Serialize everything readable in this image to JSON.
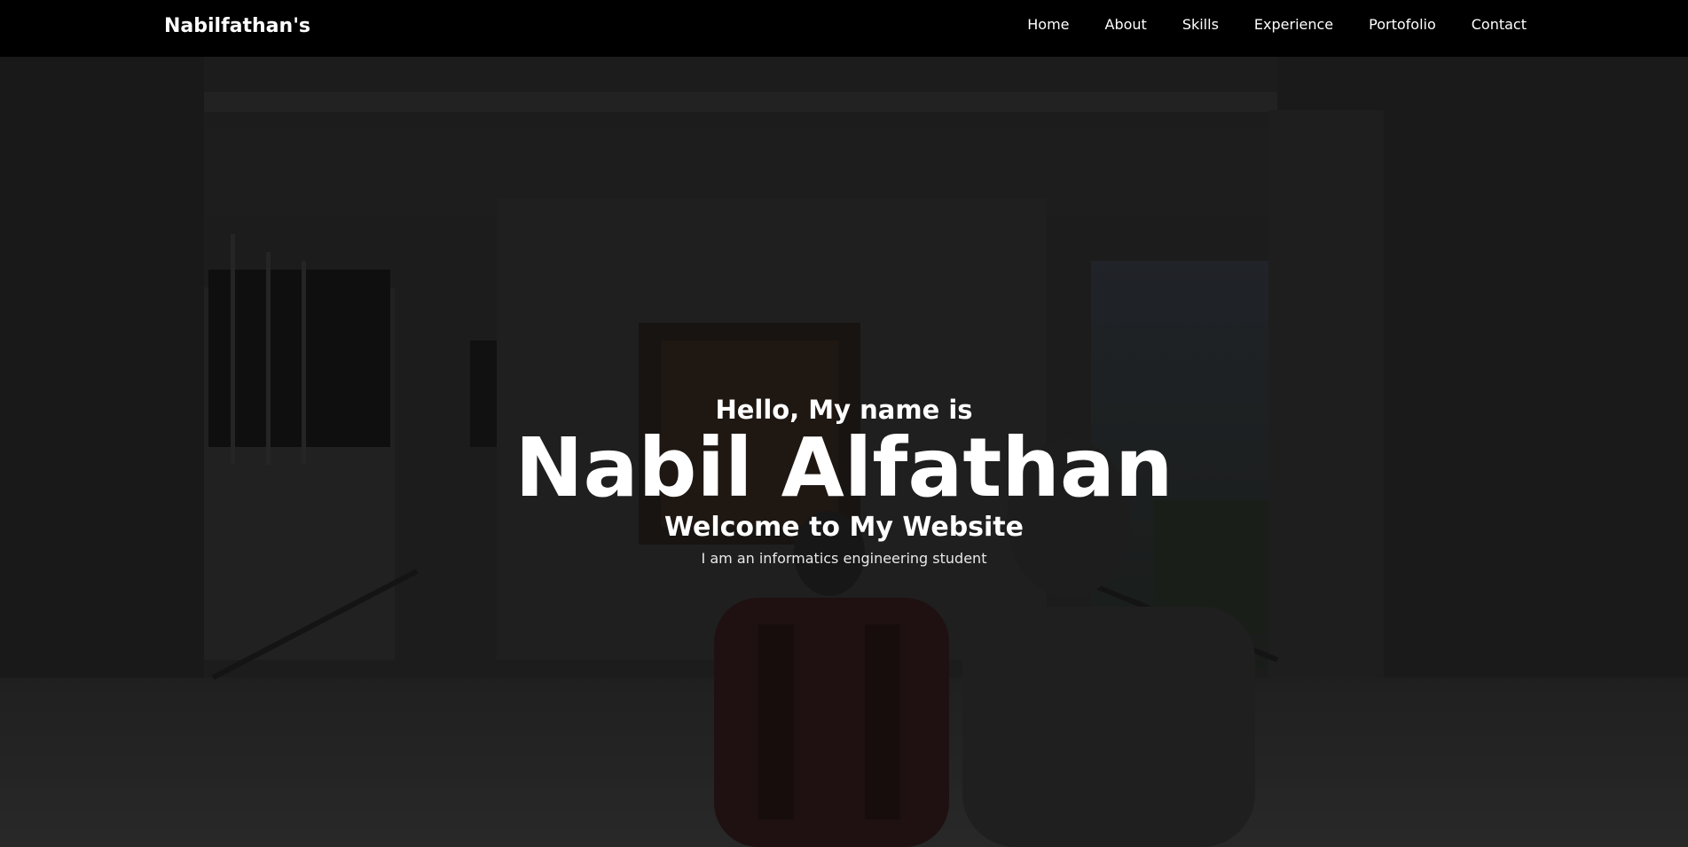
{
  "nav": {
    "brand": "Nabilfathan's",
    "links": [
      "Home",
      "About",
      "Skills",
      "Experience",
      "Portofolio",
      "Contact"
    ]
  },
  "hero": {
    "greeting": "Hello, My name is",
    "name": "Nabil Alfathan",
    "welcome": "Welcome to My Website",
    "description": "I am an informatics engineering student"
  },
  "colors": {
    "navbar_bg": "#000000",
    "text": "#ffffff",
    "overlay": "rgba(0,0,0,0.45)"
  }
}
